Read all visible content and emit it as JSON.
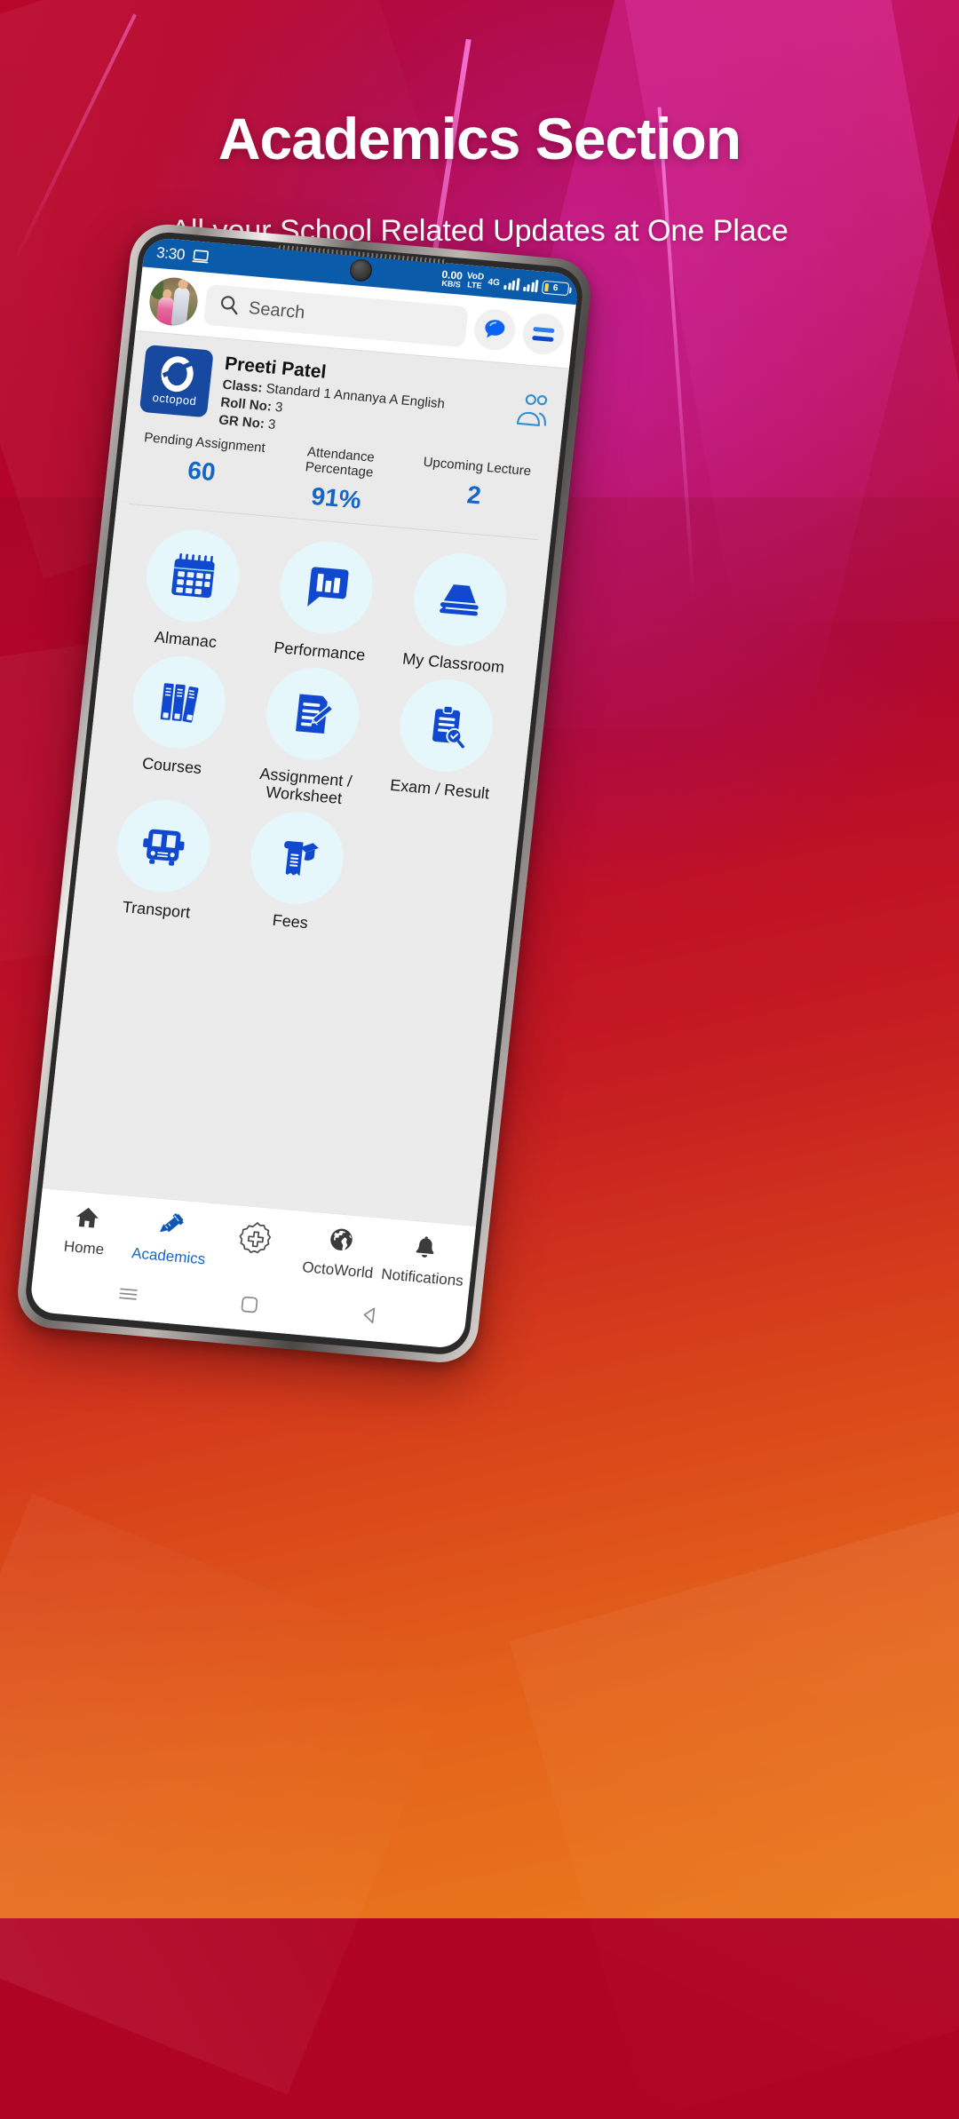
{
  "promo": {
    "title": "Academics Section",
    "subtitle": "All your School Related Updates at One Place"
  },
  "colors": {
    "accent_blue": "#1565c7",
    "logo_blue": "#16499f",
    "statusbar_blue": "#0b5bab",
    "icon_blue": "#1049d0",
    "bubble_bg": "#e6f7fb",
    "bg_red": "#b8052a",
    "bg_orange": "#ea7a1d",
    "bg_magenta": "#be1a8c"
  },
  "statusbar": {
    "time": "3:30",
    "cast_icon": "cast-screen-icon",
    "data_rate_value": "0.00",
    "data_rate_unit": "KB/S",
    "volte_line1": "VoD",
    "volte_line2": "LTE",
    "network_type": "4G",
    "signal_icon_1": "signal-bars-icon",
    "signal_icon_2": "signal-bars-icon",
    "battery_level": "6"
  },
  "appbar": {
    "avatar": "user-avatar",
    "search_placeholder": "Search",
    "search_value": "",
    "search_icon": "search-icon",
    "chat_icon": "chat-bubble-icon",
    "menu_icon": "hamburger-menu-icon"
  },
  "profile": {
    "logo_text": "octopod",
    "student_name": "Preeti Patel",
    "class_label": "Class:",
    "class_value": "Standard 1 Annanya A English",
    "roll_label": "Roll No:",
    "roll_value": "3",
    "gr_label": "GR No:",
    "gr_value": "3",
    "parents_icon": "parents-group-icon"
  },
  "stats": [
    {
      "label": "Pending Assignment",
      "value": "60"
    },
    {
      "label": "Attendance Percentage",
      "value": "91%"
    },
    {
      "label": "Upcoming Lecture",
      "value": "2"
    }
  ],
  "grid": [
    {
      "label": "Almanac",
      "icon": "calendar-icon"
    },
    {
      "label": "Performance",
      "icon": "bar-chart-bubble-icon"
    },
    {
      "label": "My Classroom",
      "icon": "books-stack-icon"
    },
    {
      "label": "Courses",
      "icon": "book-shelf-icon"
    },
    {
      "label": "Assignment / Worksheet",
      "icon": "document-pencil-icon"
    },
    {
      "label": "Exam / Result",
      "icon": "clipboard-search-icon"
    },
    {
      "label": "Transport",
      "icon": "school-bus-icon"
    },
    {
      "label": "Fees",
      "icon": "receipt-graduation-icon"
    }
  ],
  "bottom_nav": [
    {
      "label": "Home",
      "icon": "home-icon",
      "active": false
    },
    {
      "label": "Academics",
      "icon": "ruler-pencil-icon",
      "active": true
    },
    {
      "label": "",
      "icon": "plus-badge-icon",
      "active": false
    },
    {
      "label": "OctoWorld",
      "icon": "globe-icon",
      "active": false
    },
    {
      "label": "Notifications",
      "icon": "bell-icon",
      "active": false
    }
  ],
  "system_nav": {
    "recents_icon": "recents-icon",
    "home_icon": "home-square-icon",
    "back_icon": "back-triangle-icon"
  }
}
